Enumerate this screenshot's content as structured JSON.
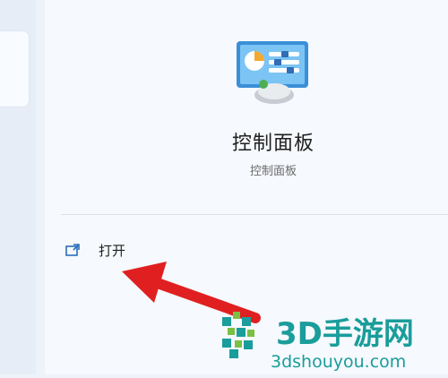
{
  "app": {
    "title": "控制面板",
    "subtitle": "控制面板",
    "icon": "control-panel-icon"
  },
  "actions": [
    {
      "label": "打开",
      "icon": "open-window-icon"
    }
  ],
  "annotation": {
    "arrow_color": "#e02020"
  },
  "watermark": {
    "brand": "3D手游网",
    "url": "3dshouyou.com",
    "color": "#1a9d9b"
  }
}
